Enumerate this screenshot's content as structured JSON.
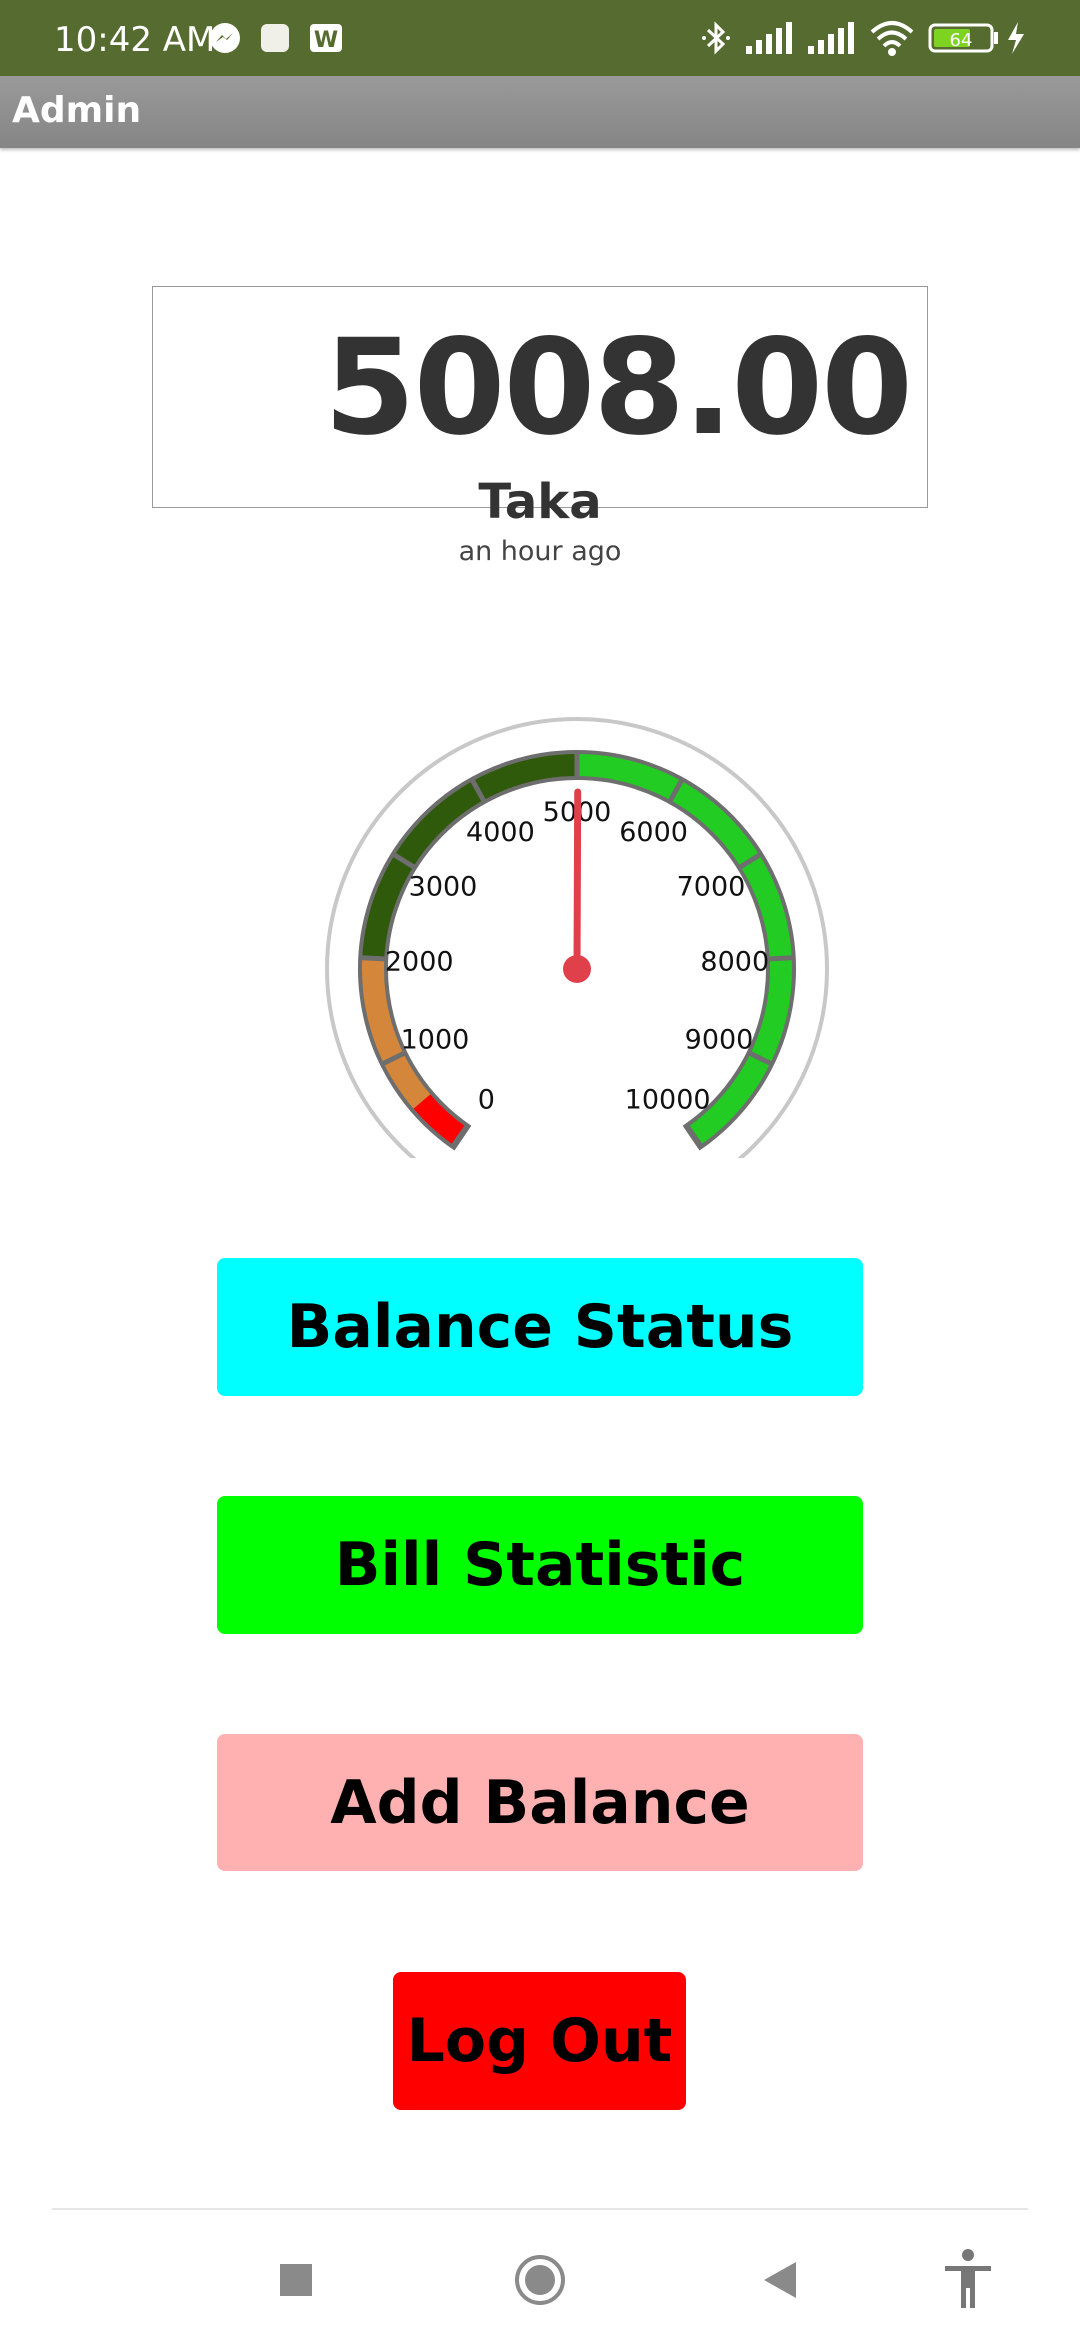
{
  "status_bar": {
    "time": "10:42 AM",
    "battery_level": "64",
    "icons": [
      "messenger-icon",
      "square-notification-icon",
      "w-app-icon",
      "bluetooth-icon",
      "signal-icon",
      "signal-icon",
      "wifi-icon",
      "battery-icon",
      "charging-icon"
    ]
  },
  "app_bar": {
    "title": "Admin"
  },
  "balance": {
    "amount": "5008.00",
    "currency": "Taka",
    "updated": "an hour ago"
  },
  "gauge": {
    "value": 5008,
    "min": 0,
    "max": 10000,
    "tick_labels": [
      "0",
      "1000",
      "2000",
      "3000",
      "4000",
      "5000",
      "6000",
      "7000",
      "8000",
      "9000",
      "10000"
    ],
    "zones": [
      {
        "from": 0,
        "to": 500,
        "color": "#ff0000"
      },
      {
        "from": 500,
        "to": 2000,
        "color": "#d4873a"
      },
      {
        "from": 2000,
        "to": 5000,
        "color": "#2f5a0c"
      },
      {
        "from": 5000,
        "to": 10000,
        "color": "#22cc22"
      }
    ],
    "needle_color": "#e0404a"
  },
  "buttons": {
    "balance_status": "Balance Status",
    "bill_statistic": "Bill Statistic",
    "add_balance": "Add Balance",
    "log_out": "Log Out"
  },
  "colors": {
    "status_bar": "#556b2f",
    "balance_status": "#00ffff",
    "bill_statistic": "#00ff00",
    "add_balance": "#ffb0b0",
    "log_out": "#ff0000"
  },
  "nav_bar": {
    "icons": [
      "recents-square-icon",
      "home-circle-icon",
      "back-triangle-icon",
      "accessibility-icon"
    ]
  }
}
